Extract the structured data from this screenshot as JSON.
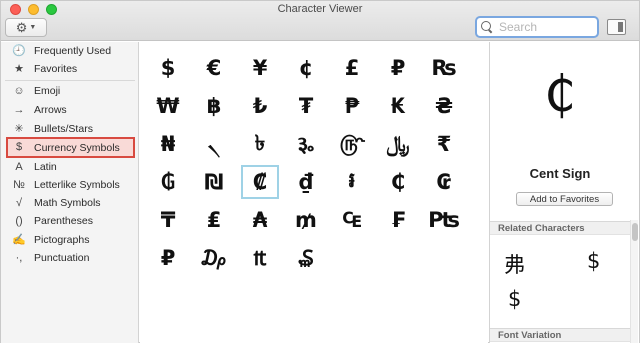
{
  "window": {
    "title": "Character Viewer"
  },
  "toolbar": {
    "action_icon": "gear-icon",
    "dropdown_icon": "chevron-down-icon",
    "search_placeholder": "Search",
    "panel_icon": "sidebar-panel-icon"
  },
  "sidebar": {
    "items": [
      {
        "label": "Frequently Used",
        "icon": "🕘",
        "icon_name": "clock-icon"
      },
      {
        "label": "Favorites",
        "icon": "★",
        "icon_name": "star-icon"
      },
      {
        "label": "Emoji",
        "icon": "☺",
        "icon_name": "smiley-icon"
      },
      {
        "label": "Arrows",
        "icon": "→",
        "icon_name": "arrow-icon"
      },
      {
        "label": "Bullets/Stars",
        "icon": "✳",
        "icon_name": "asterisk-icon"
      },
      {
        "label": "Currency Symbols",
        "icon": "$",
        "icon_name": "dollar-icon",
        "selected": true
      },
      {
        "label": "Latin",
        "icon": "A",
        "icon_name": "letter-a-icon"
      },
      {
        "label": "Letterlike Symbols",
        "icon": "№",
        "icon_name": "numero-icon"
      },
      {
        "label": "Math Symbols",
        "icon": "√",
        "icon_name": "square-root-icon"
      },
      {
        "label": "Parentheses",
        "icon": "()",
        "icon_name": "parentheses-icon"
      },
      {
        "label": "Pictographs",
        "icon": "✍",
        "icon_name": "writing-hand-icon"
      },
      {
        "label": "Punctuation",
        "icon": "·,",
        "icon_name": "punctuation-icon"
      }
    ]
  },
  "grid": {
    "characters": [
      "$",
      "€",
      "¥",
      "¢",
      "£",
      "₽",
      "₨",
      "₩",
      "฿",
      "₺",
      "₮",
      "₱",
      "₭",
      "₴",
      "₦",
      "৲",
      "৳",
      "૱",
      "௹",
      "﷼",
      "₹",
      "₲",
      "₪",
      "₡",
      "₫",
      "៛",
      "₵",
      "₢",
      "₸",
      "₤",
      "₳",
      "₥",
      "₠",
      "₣",
      "₧",
      "₽",
      "₯",
      "₶",
      "₷"
    ],
    "selected_index": 23
  },
  "info": {
    "glyph": "₵",
    "name": "Cent Sign",
    "add_favorites_label": "Add to Favorites",
    "related_header": "Related Characters",
    "related": [
      "弗",
      "$",
      "$"
    ],
    "font_variation_header": "Font Variation"
  }
}
